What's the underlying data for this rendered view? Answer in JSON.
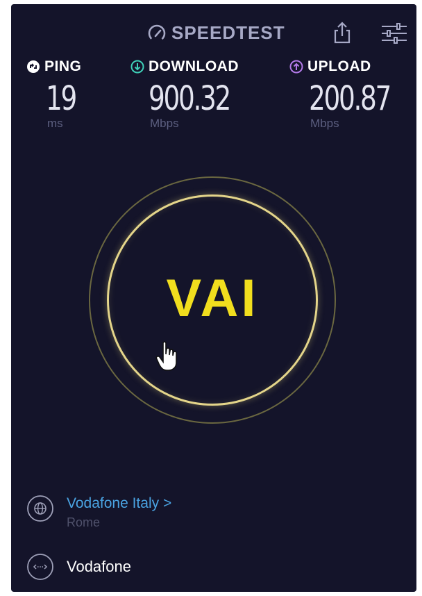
{
  "header": {
    "brand": "SPEEDTEST",
    "icons": {
      "logo": "speedometer-icon",
      "share": "share-icon",
      "settings": "sliders-icon"
    }
  },
  "metrics": {
    "ping": {
      "label": "PING",
      "value": "19",
      "unit": "ms",
      "icon": "ping-icon",
      "color": "#ffffff"
    },
    "download": {
      "label": "DOWNLOAD",
      "value": "900.32",
      "unit": "Mbps",
      "icon": "download-arrow-icon",
      "color": "#3fd0b8"
    },
    "upload": {
      "label": "UPLOAD",
      "value": "200.87",
      "unit": "Mbps",
      "icon": "upload-arrow-icon",
      "color": "#b27ae8"
    }
  },
  "go_button": {
    "label": "VAI",
    "ring_color": "#e4d58a",
    "label_color": "#f1de1e"
  },
  "server": {
    "name": "Vodafone Italy >",
    "location": "Rome",
    "icon": "globe-icon"
  },
  "provider": {
    "name": "Vodafone",
    "icon": "connection-icon"
  },
  "colors": {
    "background": "#14142a",
    "accent_link": "#4aa3e2"
  }
}
